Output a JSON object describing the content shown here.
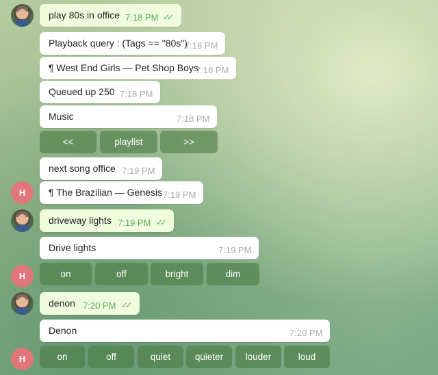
{
  "avatars": {
    "bot_letter": "H"
  },
  "messages": [
    {
      "id": "m1",
      "text": "play 80s in office",
      "time": "7:18 PM",
      "read": "✓✓"
    },
    {
      "id": "m2",
      "text": "Playback query : (Tags == \"80s\")",
      "time": "7:18 PM"
    },
    {
      "id": "m3",
      "text": "¶ West End Girls — Pet Shop Boys",
      "time": "7:18 PM"
    },
    {
      "id": "m4",
      "text": "Queued up 250",
      "time": "7:18 PM"
    },
    {
      "id": "m5",
      "text": "Music",
      "time": "7:18 PM"
    },
    {
      "id": "m6",
      "text": "next song office",
      "time": "7:19 PM"
    },
    {
      "id": "m7",
      "text": "¶ The Brazilian — Genesis",
      "time": "7:19 PM"
    },
    {
      "id": "m8",
      "text": "driveway lights",
      "time": "7:19 PM",
      "read": "✓✓"
    },
    {
      "id": "m9",
      "text": "Drive lights",
      "time": "7:19 PM"
    },
    {
      "id": "m10",
      "text": "denon",
      "time": "7:20 PM",
      "read": "✓✓"
    },
    {
      "id": "m11",
      "text": "Denon",
      "time": "7:20 PM"
    }
  ],
  "keyboards": {
    "music": [
      "<<",
      "playlist",
      ">>"
    ],
    "lights": [
      "on",
      "off",
      "bright",
      "dim"
    ],
    "denon": [
      "on",
      "off",
      "quiet",
      "quieter",
      "louder",
      "loud"
    ]
  }
}
